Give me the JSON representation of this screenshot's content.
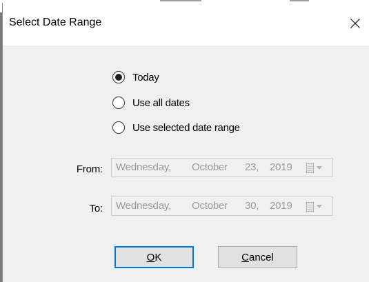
{
  "dialog": {
    "title": "Select Date Range",
    "close_icon": "close-icon"
  },
  "options": {
    "today": {
      "label": "Today",
      "selected": true
    },
    "all_dates": {
      "label": "Use all dates",
      "selected": false
    },
    "selected_range": {
      "label": "Use selected date range",
      "selected": false
    }
  },
  "from": {
    "label": "From:",
    "weekday": "Wednesday,",
    "month": "October",
    "day": "23,",
    "year": "2019",
    "enabled": false
  },
  "to": {
    "label": "To:",
    "weekday": "Wednesday,",
    "month": "October",
    "day": "30,",
    "year": "2019",
    "enabled": false
  },
  "buttons": {
    "ok": {
      "mnemonic": "O",
      "rest": "K"
    },
    "cancel": {
      "mnemonic": "C",
      "rest": "ancel"
    }
  },
  "colors": {
    "focus_border": "#0078d7",
    "dialog_bg": "#f0f0f0",
    "disabled_text": "#9a9a9a"
  }
}
